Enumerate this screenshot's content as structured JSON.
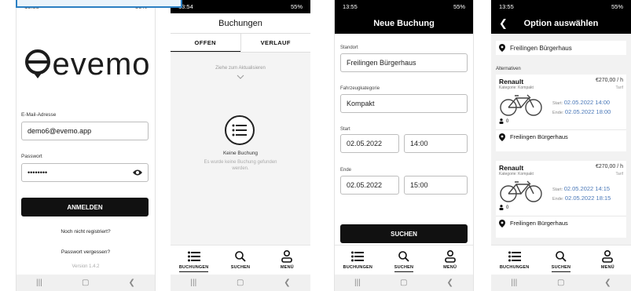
{
  "screen_login": {
    "status_time": "13:53",
    "status_right": "56%",
    "logo_text": "evemo",
    "email_label": "E-Mail-Adresse",
    "email_value": "demo6@evemo.app",
    "password_label": "Passwort",
    "password_value": "••••••••",
    "login_button": "ANMELDEN",
    "register_link": "Noch nicht registriert?",
    "forgot_link": "Passwort vergessen?",
    "version": "Version 1.4.2"
  },
  "screen_bookings": {
    "status_time": "13:54",
    "status_right": "55%",
    "title": "Buchungen",
    "tab_open": "OFFEN",
    "tab_history": "VERLAUF",
    "pull_hint": "Ziehe zum Aktualisieren",
    "empty_title": "Keine Buchung",
    "empty_sub": "Es wurde keine Buchung gefunden werden."
  },
  "screen_new": {
    "status_time": "13:55",
    "status_right": "55%",
    "title": "Neue Buchung",
    "location_label": "Standort",
    "location_value": "Freilingen Bürgerhaus",
    "category_label": "Fahrzeugkategorie",
    "category_value": "Kompakt",
    "start_label": "Start",
    "start_date": "02.05.2022",
    "start_time": "14:00",
    "end_label": "Ende",
    "end_date": "02.05.2022",
    "end_time": "15:00",
    "search_button": "SUCHEN"
  },
  "screen_options": {
    "status_time": "13:55",
    "status_right": "55%",
    "title": "Option auswählen",
    "selected_location": "Freilingen Bürgerhaus",
    "alternatives_label": "Alternativen",
    "cards": [
      {
        "brand": "Renault",
        "category": "Kategorie: Kompakt",
        "price": "€270,00 / h",
        "tarif": "Tarif",
        "start_label": "Start:",
        "start": "02.05.2022 14:00",
        "end_label": "Ende:",
        "end": "02.05.2022 18:00",
        "seats": "0",
        "location": "Freilingen Bürgerhaus"
      },
      {
        "brand": "Renault",
        "category": "Kategorie: Kompakt",
        "price": "€270,00 / h",
        "tarif": "Tarif",
        "start_label": "Start:",
        "start": "02.05.2022 14:15",
        "end_label": "Ende:",
        "end": "02.05.2022 18:15",
        "seats": "0",
        "location": "Freilingen Bürgerhaus"
      }
    ]
  },
  "tabbar": {
    "bookings": "BUCHUNGEN",
    "search": "SUCHEN",
    "menu": "MENÜ"
  },
  "colors": {
    "primary": "#111111",
    "accent_time": "#4a78b8",
    "highlight": "#2b7fc2"
  }
}
